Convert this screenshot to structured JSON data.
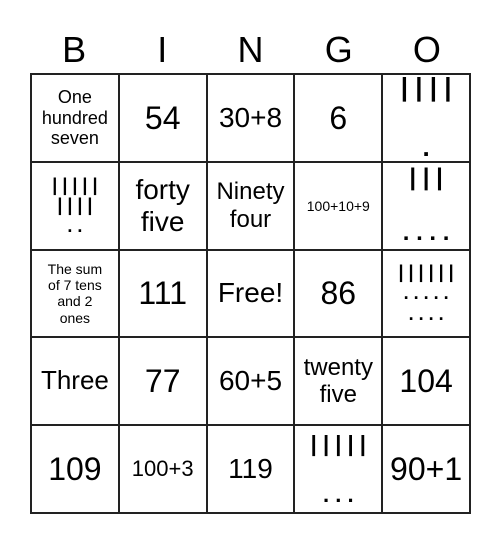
{
  "header": [
    "B",
    "I",
    "N",
    "G",
    "O"
  ],
  "cells": [
    [
      "One\nhundred\nseven",
      "54",
      "30+8",
      "6",
      "| | | |\n\n."
    ],
    [
      "| | | | |\n| | | |\n. .",
      "forty\nfive",
      "Ninety\nfour",
      "100+10+9",
      "| | |\n\n. . . ."
    ],
    [
      "The sum\nof 7 tens\nand 2\nones",
      "111",
      "Free!",
      "86",
      "| | | | | |\n. . . . .\n. . . ."
    ],
    [
      "Three",
      "77",
      "60+5",
      "twenty\nfive",
      "104"
    ],
    [
      "109",
      "100+3",
      "119",
      "| | | | |\n\n. . .",
      "90+1"
    ]
  ]
}
